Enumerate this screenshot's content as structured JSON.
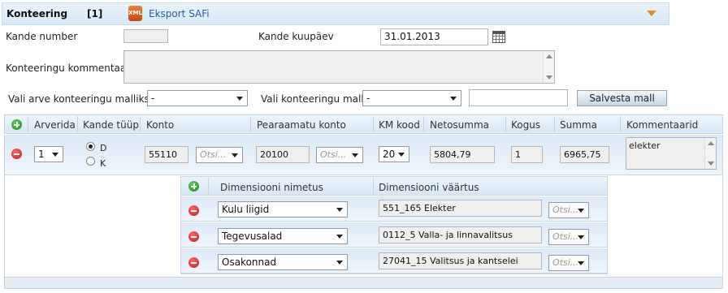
{
  "header": {
    "title": "Konteering",
    "count": "[1]",
    "export_icon_text": "XML",
    "export_link": "Eksport SAFi"
  },
  "form": {
    "kande_number_label": "Kande number",
    "kande_number_value": "",
    "kande_kuupaev_label": "Kande kuupäev",
    "kande_kuupaev_value": "31.01.2013",
    "kommentaar_label": "Konteeringu kommentaar",
    "kommentaar_value": "",
    "arve_mall_label": "Vali arve konteeringu malliks",
    "arve_mall_value": "-",
    "konteeringu_mall_label": "Vali konteeringu mall",
    "konteeringu_mall_value": "-",
    "mall_name_value": "",
    "salvesta_label": "Salvesta mall"
  },
  "grid": {
    "headers": [
      "Arverida",
      "Kande tüüp",
      "Konto",
      "Pearaamatu konto",
      "KM kood",
      "Netosumma",
      "Kogus",
      "Summa",
      "Kommentaarid"
    ],
    "row": {
      "arverida": "1",
      "type_d": "D",
      "type_k": "K",
      "konto": "55110",
      "otsi": "Otsi...",
      "pearaamatu_konto": "20100",
      "km_kood": "20",
      "netosumma": "5804,79",
      "kogus": "1",
      "summa": "6965,75",
      "kommentaar": "elekter"
    }
  },
  "dimensions": {
    "headers": [
      "Dimensiooni nimetus",
      "Dimensiooni väärtus"
    ],
    "otsi": "Otsi...",
    "rows": [
      {
        "name": "Kulu liigid",
        "value": "551_165 Elekter"
      },
      {
        "name": "Tegevusalad",
        "value": "0112_5 Valla- ja linnavalitsus"
      },
      {
        "name": "Osakonnad",
        "value": "27041_15 Valitsus ja kantselei"
      }
    ]
  }
}
